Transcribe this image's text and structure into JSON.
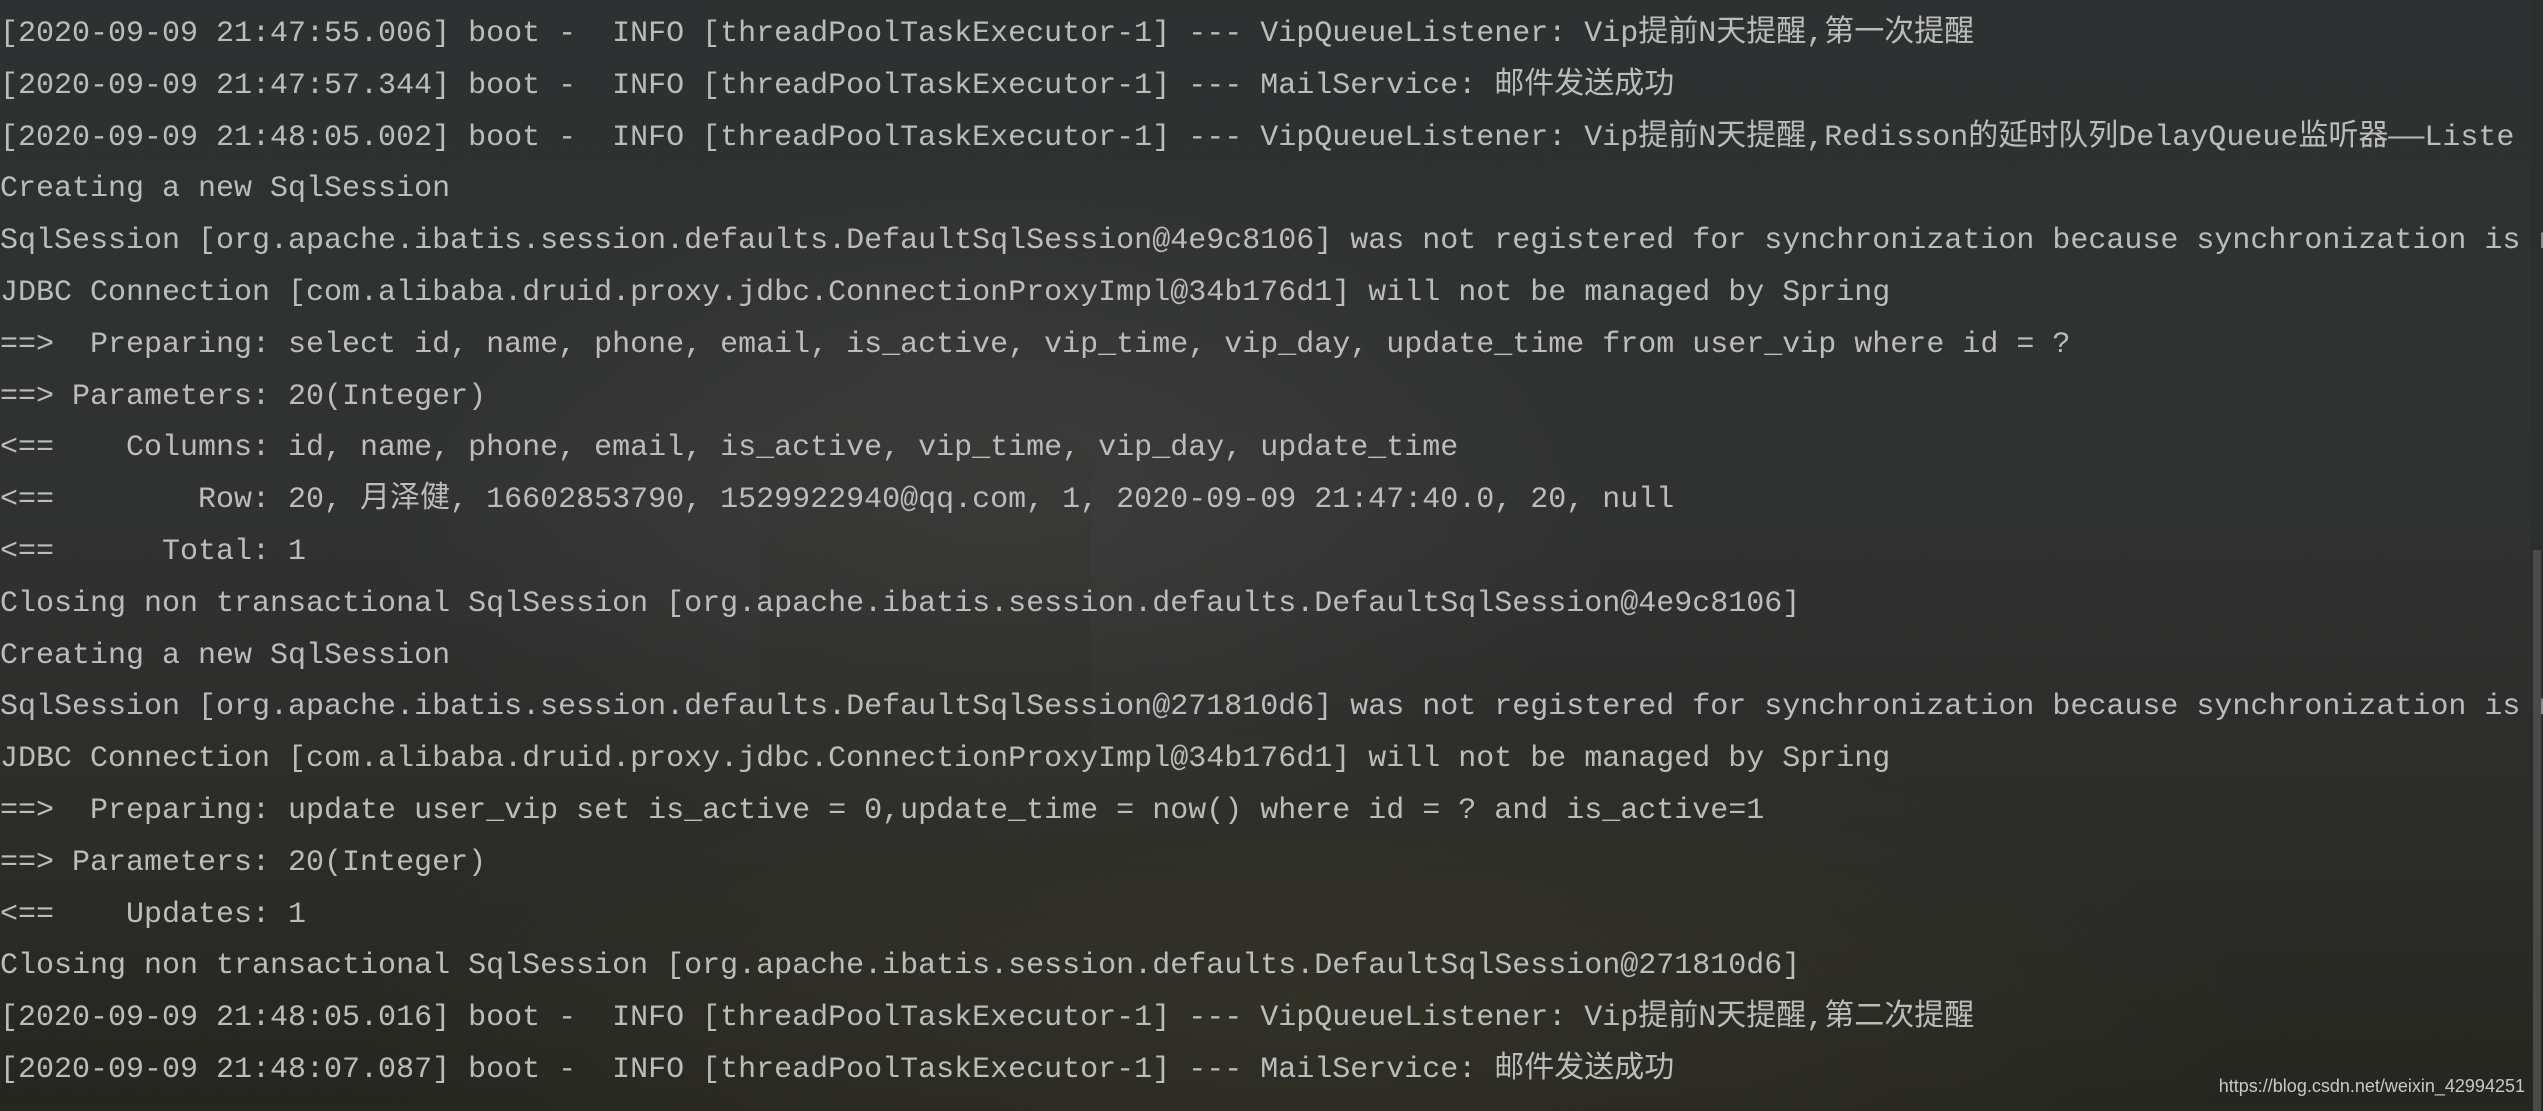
{
  "console_lines": [
    "[2020-09-09 21:47:55.006] boot -  INFO [threadPoolTaskExecutor-1] --- VipQueueListener: Vip提前N天提醒,第一次提醒",
    "[2020-09-09 21:47:57.344] boot -  INFO [threadPoolTaskExecutor-1] --- MailService: 邮件发送成功",
    "[2020-09-09 21:48:05.002] boot -  INFO [threadPoolTaskExecutor-1] --- VipQueueListener: Vip提前N天提醒,Redisson的延时队列DelayQueue监听器——Liste",
    "Creating a new SqlSession",
    "SqlSession [org.apache.ibatis.session.defaults.DefaultSqlSession@4e9c8106] was not registered for synchronization because synchronization is n",
    "JDBC Connection [com.alibaba.druid.proxy.jdbc.ConnectionProxyImpl@34b176d1] will not be managed by Spring",
    "==>  Preparing: select id, name, phone, email, is_active, vip_time, vip_day, update_time from user_vip where id = ?",
    "==> Parameters: 20(Integer)",
    "<==    Columns: id, name, phone, email, is_active, vip_time, vip_day, update_time",
    "<==        Row: 20, 月泽健, 16602853790, 1529922940@qq.com, 1, 2020-09-09 21:47:40.0, 20, null",
    "<==      Total: 1",
    "Closing non transactional SqlSession [org.apache.ibatis.session.defaults.DefaultSqlSession@4e9c8106]",
    "Creating a new SqlSession",
    "SqlSession [org.apache.ibatis.session.defaults.DefaultSqlSession@271810d6] was not registered for synchronization because synchronization is n",
    "JDBC Connection [com.alibaba.druid.proxy.jdbc.ConnectionProxyImpl@34b176d1] will not be managed by Spring",
    "==>  Preparing: update user_vip set is_active = 0,update_time = now() where id = ? and is_active=1",
    "==> Parameters: 20(Integer)",
    "<==    Updates: 1",
    "Closing non transactional SqlSession [org.apache.ibatis.session.defaults.DefaultSqlSession@271810d6]",
    "[2020-09-09 21:48:05.016] boot -  INFO [threadPoolTaskExecutor-1] --- VipQueueListener: Vip提前N天提醒,第二次提醒",
    "[2020-09-09 21:48:07.087] boot -  INFO [threadPoolTaskExecutor-1] --- MailService: 邮件发送成功"
  ],
  "watermark": "https://blog.csdn.net/weixin_42994251",
  "colors": {
    "text": "#bcbcbc",
    "background": "#2e3131"
  }
}
